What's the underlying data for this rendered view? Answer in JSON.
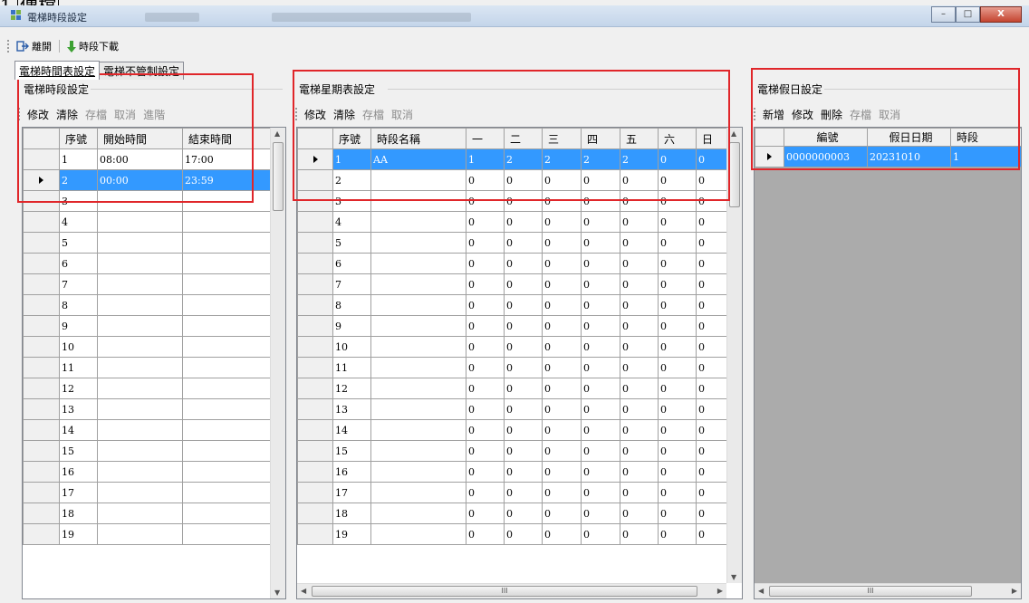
{
  "fragment_text": "傳檔",
  "window": {
    "title": "電梯時段設定",
    "min": "–",
    "max": "□",
    "close": "X"
  },
  "toolbar": {
    "exit": "離開",
    "download": "時段下載"
  },
  "tabs": [
    "電梯時間表設定",
    "電梯不管制設定"
  ],
  "period_panel": {
    "title": "電梯時段設定",
    "buttons": [
      {
        "label": "修改",
        "enabled": true
      },
      {
        "label": "清除",
        "enabled": true
      },
      {
        "label": "存檔",
        "enabled": false
      },
      {
        "label": "取消",
        "enabled": false
      },
      {
        "label": "進階",
        "enabled": false
      }
    ],
    "columns": [
      "序號",
      "開始時間",
      "結束時間"
    ],
    "rows": [
      [
        "1",
        "08:00",
        "17:00"
      ],
      [
        "2",
        "00:00",
        "23:59"
      ],
      [
        "3",
        "",
        ""
      ],
      [
        "4",
        "",
        ""
      ],
      [
        "5",
        "",
        ""
      ],
      [
        "6",
        "",
        ""
      ],
      [
        "7",
        "",
        ""
      ],
      [
        "8",
        "",
        ""
      ],
      [
        "9",
        "",
        ""
      ],
      [
        "10",
        "",
        ""
      ],
      [
        "11",
        "",
        ""
      ],
      [
        "12",
        "",
        ""
      ],
      [
        "13",
        "",
        ""
      ],
      [
        "14",
        "",
        ""
      ],
      [
        "15",
        "",
        ""
      ],
      [
        "16",
        "",
        ""
      ],
      [
        "17",
        "",
        ""
      ],
      [
        "18",
        "",
        ""
      ],
      [
        "19",
        "",
        ""
      ]
    ]
  },
  "weekly_panel": {
    "title": "電梯星期表設定",
    "buttons": [
      {
        "label": "修改",
        "enabled": true
      },
      {
        "label": "清除",
        "enabled": true
      },
      {
        "label": "存檔",
        "enabled": false
      },
      {
        "label": "取消",
        "enabled": false
      }
    ],
    "columns": [
      "序號",
      "時段名稱",
      "一",
      "二",
      "三",
      "四",
      "五",
      "六",
      "日"
    ],
    "rows": [
      [
        "1",
        "AA",
        "1",
        "2",
        "2",
        "2",
        "2",
        "0",
        "0"
      ],
      [
        "2",
        "",
        "0",
        "0",
        "0",
        "0",
        "0",
        "0",
        "0"
      ],
      [
        "3",
        "",
        "0",
        "0",
        "0",
        "0",
        "0",
        "0",
        "0"
      ],
      [
        "4",
        "",
        "0",
        "0",
        "0",
        "0",
        "0",
        "0",
        "0"
      ],
      [
        "5",
        "",
        "0",
        "0",
        "0",
        "0",
        "0",
        "0",
        "0"
      ],
      [
        "6",
        "",
        "0",
        "0",
        "0",
        "0",
        "0",
        "0",
        "0"
      ],
      [
        "7",
        "",
        "0",
        "0",
        "0",
        "0",
        "0",
        "0",
        "0"
      ],
      [
        "8",
        "",
        "0",
        "0",
        "0",
        "0",
        "0",
        "0",
        "0"
      ],
      [
        "9",
        "",
        "0",
        "0",
        "0",
        "0",
        "0",
        "0",
        "0"
      ],
      [
        "10",
        "",
        "0",
        "0",
        "0",
        "0",
        "0",
        "0",
        "0"
      ],
      [
        "11",
        "",
        "0",
        "0",
        "0",
        "0",
        "0",
        "0",
        "0"
      ],
      [
        "12",
        "",
        "0",
        "0",
        "0",
        "0",
        "0",
        "0",
        "0"
      ],
      [
        "13",
        "",
        "0",
        "0",
        "0",
        "0",
        "0",
        "0",
        "0"
      ],
      [
        "14",
        "",
        "0",
        "0",
        "0",
        "0",
        "0",
        "0",
        "0"
      ],
      [
        "15",
        "",
        "0",
        "0",
        "0",
        "0",
        "0",
        "0",
        "0"
      ],
      [
        "16",
        "",
        "0",
        "0",
        "0",
        "0",
        "0",
        "0",
        "0"
      ],
      [
        "17",
        "",
        "0",
        "0",
        "0",
        "0",
        "0",
        "0",
        "0"
      ],
      [
        "18",
        "",
        "0",
        "0",
        "0",
        "0",
        "0",
        "0",
        "0"
      ],
      [
        "19",
        "",
        "0",
        "0",
        "0",
        "0",
        "0",
        "0",
        "0"
      ]
    ]
  },
  "holiday_panel": {
    "title": "電梯假日設定",
    "buttons": [
      {
        "label": "新增",
        "enabled": true
      },
      {
        "label": "修改",
        "enabled": true
      },
      {
        "label": "刪除",
        "enabled": true
      },
      {
        "label": "存檔",
        "enabled": false
      },
      {
        "label": "取消",
        "enabled": false
      }
    ],
    "columns": [
      "編號",
      "假日日期",
      "時段"
    ],
    "rows": [
      [
        "0000000003",
        "20231010",
        "1"
      ]
    ]
  },
  "colors": {
    "selection": "#3399ff",
    "highlight_box": "#e0262a"
  }
}
